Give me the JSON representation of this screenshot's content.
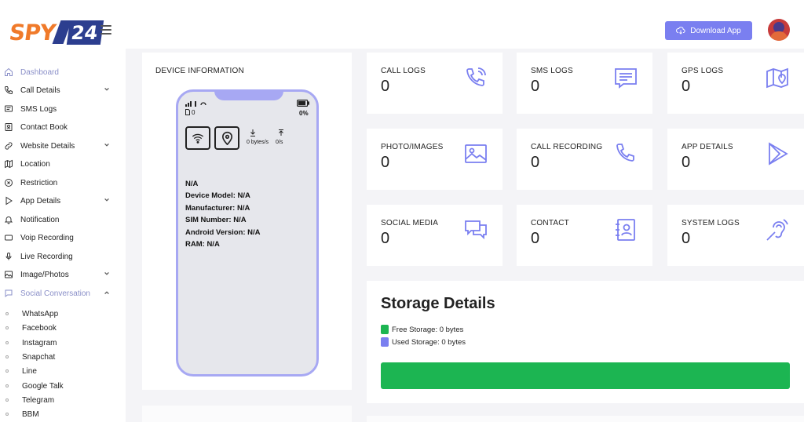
{
  "header": {
    "logo_text": "SPY",
    "logo_num": "24",
    "download_label": "Download App"
  },
  "sidebar": {
    "items": [
      {
        "label": "Dashboard",
        "icon": "home-icon"
      },
      {
        "label": "Call Details",
        "icon": "phone-icon"
      },
      {
        "label": "SMS Logs",
        "icon": "message-icon"
      },
      {
        "label": "Contact Book",
        "icon": "contact-book-icon"
      },
      {
        "label": "Website Details",
        "icon": "link-icon"
      },
      {
        "label": "Location",
        "icon": "map-icon"
      },
      {
        "label": "Restriction",
        "icon": "restriction-icon"
      },
      {
        "label": "App Details",
        "icon": "play-icon"
      },
      {
        "label": "Notification",
        "icon": "bell-icon"
      },
      {
        "label": "Voip Recording",
        "icon": "voip-icon"
      },
      {
        "label": "Live Recording",
        "icon": "mic-icon"
      },
      {
        "label": "Image/Photos",
        "icon": "image-icon"
      },
      {
        "label": "Social Conversation",
        "icon": "chat-icon"
      }
    ],
    "social_items": [
      "WhatsApp",
      "Facebook",
      "Instagram",
      "Snapchat",
      "Line",
      "Google Talk",
      "Telegram",
      "BBM"
    ]
  },
  "device": {
    "title": "DEVICE INFORMATION",
    "status_left": "0",
    "battery": "0%",
    "download_speed": "0 bytes/s",
    "upload_speed": "0/s",
    "name": "N/A",
    "model": "Device Model: N/A",
    "manufacturer": "Manufacturer: N/A",
    "sim": "SIM Number: N/A",
    "android": "Android Version: N/A",
    "ram": "RAM: N/A"
  },
  "stats": [
    {
      "label": "CALL LOGS",
      "value": "0",
      "icon": "call-log-icon"
    },
    {
      "label": "SMS LOGS",
      "value": "0",
      "icon": "sms-icon"
    },
    {
      "label": "GPS LOGS",
      "value": "0",
      "icon": "gps-map-icon"
    },
    {
      "label": "PHOTO/IMAGES",
      "value": "0",
      "icon": "photo-icon"
    },
    {
      "label": "CALL RECORDING",
      "value": "0",
      "icon": "call-recording-icon"
    },
    {
      "label": "APP DETAILS",
      "value": "0",
      "icon": "app-play-icon"
    },
    {
      "label": "SOCIAL MEDIA",
      "value": "0",
      "icon": "social-chat-icon"
    },
    {
      "label": "CONTACT",
      "value": "0",
      "icon": "contact-icon"
    },
    {
      "label": "SYSTEM LOGS",
      "value": "0",
      "icon": "ear-icon"
    }
  ],
  "storage": {
    "title": "Storage Details",
    "free_label": "Free Storage: 0 bytes",
    "used_label": "Used Storage: 0 bytes",
    "free_color": "#1cb552",
    "used_color": "#7a7ff0",
    "free_fraction": 1.0
  }
}
